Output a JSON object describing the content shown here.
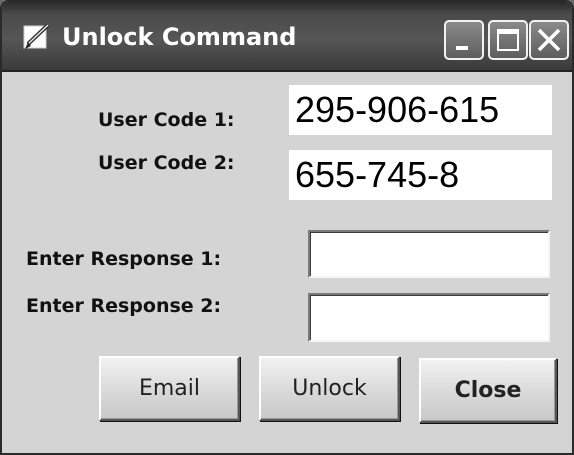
{
  "window": {
    "title": "Unlock Command",
    "icon": "edit-pencil-icon",
    "controls": {
      "minimize": "minimize-icon",
      "maximize": "maximize-icon",
      "close": "close-icon"
    }
  },
  "form": {
    "user_code_1_label": "User Code 1:",
    "user_code_1_value": "295-906-615",
    "user_code_2_label": "User Code 2:",
    "user_code_2_value": "655-745-8",
    "response_1_label": "Enter Response 1:",
    "response_1_value": "",
    "response_2_label": "Enter Response 2:",
    "response_2_value": ""
  },
  "buttons": {
    "email": "Email",
    "unlock": "Unlock",
    "close": "Close"
  },
  "colors": {
    "titlebar": "#4a4a4a",
    "client_background": "#d4d4d4",
    "field_background": "#ffffff"
  }
}
